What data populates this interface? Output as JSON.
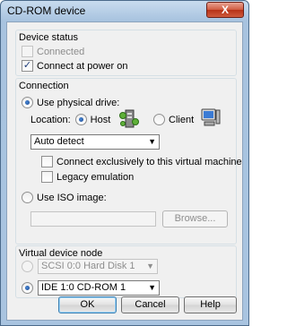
{
  "window": {
    "title": "CD-ROM device",
    "close_label": "X"
  },
  "device_status": {
    "title": "Device status",
    "connected_label": "Connected",
    "connected_checked": false,
    "connect_power_label": "Connect at power on",
    "connect_power_checked": true
  },
  "connection": {
    "title": "Connection",
    "use_physical_label": "Use physical drive:",
    "location_label": "Location:",
    "host_label": "Host",
    "client_label": "Client",
    "drive_select": "Auto detect",
    "exclusive_label": "Connect exclusively to this virtual machine",
    "legacy_label": "Legacy emulation",
    "use_iso_label": "Use ISO image:",
    "iso_path_value": "",
    "browse_label": "Browse..."
  },
  "virtual_node": {
    "title": "Virtual device node",
    "scsi_select": "SCSI 0:0   Hard Disk 1",
    "ide_select": "IDE 1:0   CD-ROM 1"
  },
  "footer": {
    "ok_label": "OK",
    "cancel_label": "Cancel",
    "help_label": "Help"
  },
  "icons": {
    "host": "host-computer-icon",
    "client": "client-computer-icon",
    "close": "close-icon"
  },
  "colors": {
    "title_bar": "#a8c3df",
    "close_button": "#c9462b",
    "dialog_bg": "#f0f0f0"
  }
}
